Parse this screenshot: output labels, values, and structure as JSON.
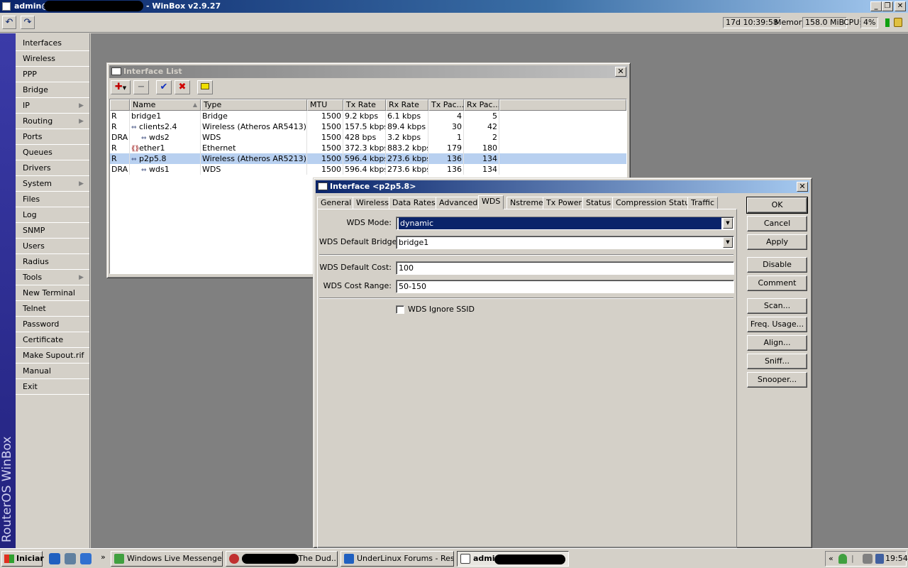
{
  "window": {
    "title": "admin@10.x.x.x - WinBox v2.9.27",
    "title_prefix": "admin@1",
    "title_suffix": "- WinBox v2.9.27"
  },
  "toolbar": {
    "uptime": "17d 10:39:58",
    "memory_label": "Memory:",
    "memory_value": "158.0 MiB",
    "cpu_label": "CPU:",
    "cpu_value": "4%"
  },
  "sidebar": {
    "brand": "RouterOS WinBox",
    "items": [
      {
        "label": "Interfaces"
      },
      {
        "label": "Wireless"
      },
      {
        "label": "PPP"
      },
      {
        "label": "Bridge"
      },
      {
        "label": "IP"
      },
      {
        "label": "Routing"
      },
      {
        "label": "Ports"
      },
      {
        "label": "Queues"
      },
      {
        "label": "Drivers"
      },
      {
        "label": "System"
      },
      {
        "label": "Files"
      },
      {
        "label": "Log"
      },
      {
        "label": "SNMP"
      },
      {
        "label": "Users"
      },
      {
        "label": "Radius"
      },
      {
        "label": "Tools"
      },
      {
        "label": "New Terminal"
      },
      {
        "label": "Telnet"
      },
      {
        "label": "Password"
      },
      {
        "label": "Certificate"
      },
      {
        "label": "Make Supout.rif"
      },
      {
        "label": "Manual"
      },
      {
        "label": "Exit"
      }
    ]
  },
  "interface_list": {
    "title": "Interface List",
    "columns": [
      "",
      "Name",
      "Type",
      "MTU",
      "Tx Rate",
      "Rx Rate",
      "Tx Pac...",
      "Rx Pac..."
    ],
    "rows": [
      {
        "flag": "R",
        "name": "bridge1",
        "type": "Bridge",
        "mtu": "1500",
        "tx": "9.2 kbps",
        "rx": "6.1 kbps",
        "txp": "4",
        "rxp": "5"
      },
      {
        "flag": "R",
        "name": "clients2.4",
        "type": "Wireless (Atheros AR5413)",
        "mtu": "1500",
        "tx": "157.5 kbps",
        "rx": "89.4 kbps",
        "txp": "30",
        "rxp": "42"
      },
      {
        "flag": "DRA",
        "name": "wds2",
        "type": "WDS",
        "mtu": "1500",
        "tx": "428 bps",
        "rx": "3.2 kbps",
        "txp": "1",
        "rxp": "2"
      },
      {
        "flag": "R",
        "name": "ether1",
        "type": "Ethernet",
        "mtu": "1500",
        "tx": "372.3 kbps",
        "rx": "883.2 kbps",
        "txp": "179",
        "rxp": "180"
      },
      {
        "flag": "R",
        "name": "p2p5.8",
        "type": "Wireless (Atheros AR5213)",
        "mtu": "1500",
        "tx": "596.4 kbps",
        "rx": "273.6 kbps",
        "txp": "136",
        "rxp": "134"
      },
      {
        "flag": "DRA",
        "name": "wds1",
        "type": "WDS",
        "mtu": "1500",
        "tx": "596.4 kbps",
        "rx": "273.6 kbps",
        "txp": "136",
        "rxp": "134"
      }
    ]
  },
  "interface_dialog": {
    "title": "Interface <p2p5.8>",
    "tabs": [
      "General",
      "Wireless",
      "Data Rates",
      "Advanced",
      "WDS",
      "Nstreme",
      "Tx Power",
      "Status",
      "Compression Status",
      "Traffic"
    ],
    "active_tab": "WDS",
    "fields": {
      "wds_mode_label": "WDS Mode:",
      "wds_mode_value": "dynamic",
      "wds_default_bridge_label": "WDS Default Bridge:",
      "wds_default_bridge_value": "bridge1",
      "wds_default_cost_label": "WDS Default Cost:",
      "wds_default_cost_value": "100",
      "wds_cost_range_label": "WDS Cost Range:",
      "wds_cost_range_value": "50-150",
      "wds_ignore_ssid_label": "WDS Ignore SSID",
      "wds_ignore_ssid_checked": false
    },
    "buttons": [
      "OK",
      "Cancel",
      "Apply",
      "Disable",
      "Comment",
      "Scan...",
      "Freq. Usage...",
      "Align...",
      "Sniff...",
      "Snooper..."
    ]
  },
  "taskbar": {
    "start": "Iniciar",
    "tasks": [
      {
        "label": "Windows Live Messenger"
      },
      {
        "label": "- The Dud..."
      },
      {
        "label": "UnderLinux Forums - Res..."
      },
      {
        "label": "admin"
      }
    ],
    "clock": "19:54"
  }
}
